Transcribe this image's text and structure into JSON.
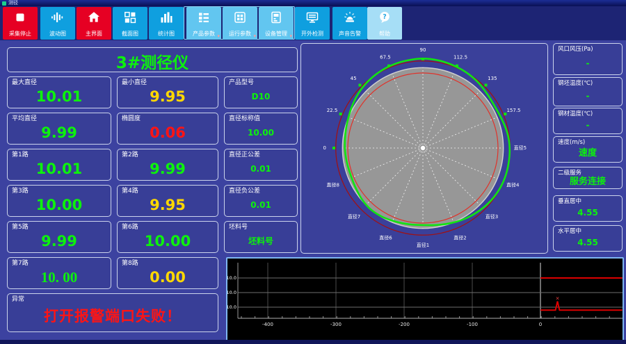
{
  "window": {
    "title": "测径"
  },
  "toolbar": {
    "buttons": [
      {
        "key": "stop-capture",
        "label": "采集停止",
        "icon": "stop-icon",
        "style": "red",
        "dropdown": false
      },
      {
        "key": "wave-chart",
        "label": "波动图",
        "icon": "waveform-icon",
        "style": "blue",
        "dropdown": false
      },
      {
        "key": "main-screen",
        "label": "主界面",
        "icon": "home-icon",
        "style": "red",
        "dropdown": false
      },
      {
        "key": "section-chart",
        "label": "截面图",
        "icon": "sections-icon",
        "style": "blue",
        "dropdown": false
      },
      {
        "key": "stats-chart",
        "label": "统计图",
        "icon": "barchart-icon",
        "style": "blue",
        "dropdown": false
      },
      {
        "key": "product-params",
        "label": "产品参数",
        "icon": "product-params-icon",
        "style": "light",
        "dropdown": true
      },
      {
        "key": "run-params",
        "label": "运行参数",
        "icon": "run-params-icon",
        "style": "light",
        "dropdown": true
      },
      {
        "key": "device-manage",
        "label": "设备管理",
        "icon": "device-manage-icon",
        "style": "light",
        "dropdown": true
      },
      {
        "key": "external-detect",
        "label": "开外检测",
        "icon": "monitor-icon",
        "style": "blue",
        "dropdown": false
      },
      {
        "key": "sound-alarm",
        "label": "声音告警",
        "icon": "siren-icon",
        "style": "blue",
        "dropdown": false
      },
      {
        "key": "help",
        "label": "帮助",
        "icon": "help-icon",
        "style": "pale",
        "dropdown": false
      }
    ]
  },
  "left_panel": {
    "title": "3#测径仪",
    "metrics": [
      {
        "label": "最大直径",
        "value": "10.01",
        "status": "ok",
        "size": "big"
      },
      {
        "label": "最小直径",
        "value": "9.95",
        "status": "warn",
        "size": "big"
      },
      {
        "label": "产品型号",
        "value": "D10",
        "status": "ok",
        "size": "small"
      },
      {
        "label": "平均直径",
        "value": "9.99",
        "status": "ok",
        "size": "big"
      },
      {
        "label": "椭圆度",
        "value": "0.06",
        "status": "alarm",
        "size": "big"
      },
      {
        "label": "直径标称值",
        "value": "10.00",
        "status": "ok",
        "size": "small"
      },
      {
        "label": "第1路",
        "value": "10.01",
        "status": "ok",
        "size": "big"
      },
      {
        "label": "第2路",
        "value": "9.99",
        "status": "ok",
        "size": "big"
      },
      {
        "label": "直径正公差",
        "value": "0.01",
        "status": "ok",
        "size": "small"
      },
      {
        "label": "第3路",
        "value": "10.00",
        "status": "ok",
        "size": "big"
      },
      {
        "label": "第4路",
        "value": "9.95",
        "status": "warn",
        "size": "big"
      },
      {
        "label": "直径负公差",
        "value": "0.01",
        "status": "ok",
        "size": "small"
      },
      {
        "label": "第5路",
        "value": "9.99",
        "status": "ok",
        "size": "big"
      },
      {
        "label": "第6路",
        "value": "10.00",
        "status": "ok",
        "size": "big"
      },
      {
        "label": "坯料号",
        "value": "坯料号",
        "status": "ok",
        "size": "small"
      },
      {
        "label": "第7路",
        "value": "10. 00",
        "status": "ok",
        "size": "big",
        "serif": true
      },
      {
        "label": "第8路",
        "value": "0.00",
        "status": "warn",
        "size": "big"
      }
    ],
    "exception": {
      "label": "异常",
      "value": "打开报警端口失败！"
    }
  },
  "right_panel": {
    "fields": [
      {
        "label": "风口风压(Pa)",
        "value": "-"
      },
      {
        "label": "钢坯温度(℃)",
        "value": "-"
      },
      {
        "label": "钢材温度(℃)",
        "value": "-"
      },
      {
        "label": "速度(m/s)",
        "value": "速度"
      },
      {
        "label": "二级服务",
        "value": "服务连接"
      },
      {
        "label": "垂直居中",
        "value": "4.55"
      },
      {
        "label": "水平居中",
        "value": "4.55"
      }
    ]
  },
  "status_colors": {
    "ok": "#0df20d",
    "warn": "#ffd800",
    "alarm": "#ff1414"
  },
  "chart_data": [
    {
      "type": "polar-profile",
      "title": "",
      "angle_labels": [
        {
          "text": "0",
          "deg": 180
        },
        {
          "text": "22.5",
          "deg": 157.5
        },
        {
          "text": "45",
          "deg": 135
        },
        {
          "text": "67.5",
          "deg": 112.5
        },
        {
          "text": "90",
          "deg": 90
        },
        {
          "text": "112.5",
          "deg": 67.5
        },
        {
          "text": "135",
          "deg": 45
        },
        {
          "text": "157.5",
          "deg": 22.5
        }
      ],
      "diameter_labels": [
        {
          "text": "直径5",
          "deg": 0
        },
        {
          "text": "直径4",
          "deg": 337.5
        },
        {
          "text": "直径3",
          "deg": 315
        },
        {
          "text": "直径2",
          "deg": 292.5
        },
        {
          "text": "直径1",
          "deg": 270
        },
        {
          "text": "直径6",
          "deg": 247.5
        },
        {
          "text": "直径7",
          "deg": 225
        },
        {
          "text": "直径8",
          "deg": 202.5
        }
      ],
      "spoke_step_deg": 22.5,
      "circles": {
        "body_fill": 0.876,
        "tolerance_inner": 0.818,
        "tolerance_outer": 0.949
      },
      "profile_start_deg": 0,
      "profile_step_deg": 10,
      "profile_radii": [
        0.945,
        0.935,
        0.915,
        0.905,
        0.915,
        0.935,
        0.95,
        0.96,
        0.97,
        0.975,
        0.97,
        0.965,
        0.955,
        0.94,
        0.92,
        0.895,
        0.872,
        0.858,
        0.85,
        0.843,
        0.84,
        0.85,
        0.868,
        0.878,
        0.87,
        0.855,
        0.845,
        0.84,
        0.852,
        0.872,
        0.895,
        0.915,
        0.933,
        0.945,
        0.95,
        0.948
      ],
      "colors": {
        "body": "#979797",
        "body_rim": "#cfcfcf",
        "profile": "#12e412",
        "tolerance_inner": "#e0322a",
        "tolerance_outer": "#9e1216",
        "spokes": "#ffffff",
        "labels": "#ffffff",
        "marker": "#12e412"
      }
    },
    {
      "type": "line",
      "title": "",
      "x_ticks": [
        -400,
        -300,
        -200,
        -100,
        0
      ],
      "x_range": [
        -444,
        120
      ],
      "y_range": [
        9.91,
        10.1
      ],
      "y_ticks": [
        {
          "value": 10.05,
          "label": "10.0"
        },
        {
          "value": 10.0,
          "label": "10.0"
        },
        {
          "value": 9.95,
          "label": "10.0"
        }
      ],
      "series": [
        {
          "name": "upper-limit-trace",
          "color": "#dd0000",
          "points": [
            [
              0,
              10.05
            ],
            [
              120,
              10.05
            ]
          ]
        },
        {
          "name": "measured-trace",
          "color": "#dd0000",
          "points": [
            [
              0,
              9.94
            ],
            [
              22,
              9.94
            ],
            [
              25,
              9.97
            ],
            [
              28,
              9.94
            ],
            [
              120,
              9.94
            ]
          ],
          "marker": {
            "x": 25,
            "y": 9.97,
            "glyph": "×"
          }
        }
      ],
      "plot_bg": "#000000",
      "grid": true,
      "legend": "none"
    }
  ]
}
